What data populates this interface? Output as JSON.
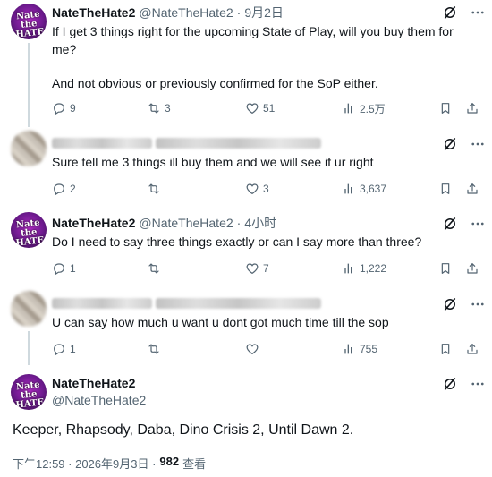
{
  "tweets": [
    {
      "author_name": "NateTheHate2",
      "handle": "@NateTheHate2",
      "dot": "·",
      "time": "9月2日",
      "text_line1": "If I get 3 things right for the upcoming State of Play, will you buy them for",
      "text_line2": "me?",
      "text_line3": "And not obvious or previously confirmed for the SoP either.",
      "replies": "9",
      "retweets": "3",
      "likes": "51",
      "views": "2.5万"
    },
    {
      "text": "Sure tell me 3 things ill buy them and we will see if ur right",
      "replies": "2",
      "retweets": "",
      "likes": "3",
      "views": "3,637"
    },
    {
      "author_name": "NateTheHate2",
      "handle": "@NateTheHate2",
      "dot": "·",
      "time": "4小时",
      "text": "Do I need to say three things exactly or can I say more than three?",
      "replies": "1",
      "retweets": "",
      "likes": "7",
      "views": "1,222"
    },
    {
      "text": "U can say how much u want u dont got much time till the sop",
      "replies": "1",
      "retweets": "",
      "likes": "",
      "views": "755"
    }
  ],
  "main_tweet": {
    "author_name": "NateTheHate2",
    "handle": "@NateTheHate2",
    "text": "Keeper, Rhapsody, Daba, Dino Crisis 2, Until Dawn 2.",
    "timestamp": "下午12:59 · 2026年9月3日 ·",
    "views_count": "982",
    "views_label": "查看"
  },
  "avatar_logo_text": "Nate the HATE",
  "colors": {
    "text": "#0f1419",
    "secondary": "#536471",
    "divider": "#eff3f4",
    "thread": "#cfd9de"
  }
}
